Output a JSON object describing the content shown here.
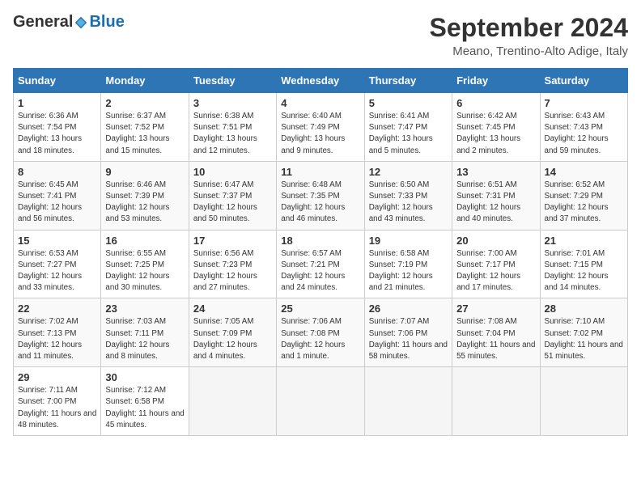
{
  "logo": {
    "general": "General",
    "blue": "Blue"
  },
  "header": {
    "month": "September 2024",
    "location": "Meano, Trentino-Alto Adige, Italy"
  },
  "columns": [
    "Sunday",
    "Monday",
    "Tuesday",
    "Wednesday",
    "Thursday",
    "Friday",
    "Saturday"
  ],
  "weeks": [
    [
      {
        "day": "1",
        "sunrise": "6:36 AM",
        "sunset": "7:54 PM",
        "daylight": "13 hours and 18 minutes."
      },
      {
        "day": "2",
        "sunrise": "6:37 AM",
        "sunset": "7:52 PM",
        "daylight": "13 hours and 15 minutes."
      },
      {
        "day": "3",
        "sunrise": "6:38 AM",
        "sunset": "7:51 PM",
        "daylight": "13 hours and 12 minutes."
      },
      {
        "day": "4",
        "sunrise": "6:40 AM",
        "sunset": "7:49 PM",
        "daylight": "13 hours and 9 minutes."
      },
      {
        "day": "5",
        "sunrise": "6:41 AM",
        "sunset": "7:47 PM",
        "daylight": "13 hours and 5 minutes."
      },
      {
        "day": "6",
        "sunrise": "6:42 AM",
        "sunset": "7:45 PM",
        "daylight": "13 hours and 2 minutes."
      },
      {
        "day": "7",
        "sunrise": "6:43 AM",
        "sunset": "7:43 PM",
        "daylight": "12 hours and 59 minutes."
      }
    ],
    [
      {
        "day": "8",
        "sunrise": "6:45 AM",
        "sunset": "7:41 PM",
        "daylight": "12 hours and 56 minutes."
      },
      {
        "day": "9",
        "sunrise": "6:46 AM",
        "sunset": "7:39 PM",
        "daylight": "12 hours and 53 minutes."
      },
      {
        "day": "10",
        "sunrise": "6:47 AM",
        "sunset": "7:37 PM",
        "daylight": "12 hours and 50 minutes."
      },
      {
        "day": "11",
        "sunrise": "6:48 AM",
        "sunset": "7:35 PM",
        "daylight": "12 hours and 46 minutes."
      },
      {
        "day": "12",
        "sunrise": "6:50 AM",
        "sunset": "7:33 PM",
        "daylight": "12 hours and 43 minutes."
      },
      {
        "day": "13",
        "sunrise": "6:51 AM",
        "sunset": "7:31 PM",
        "daylight": "12 hours and 40 minutes."
      },
      {
        "day": "14",
        "sunrise": "6:52 AM",
        "sunset": "7:29 PM",
        "daylight": "12 hours and 37 minutes."
      }
    ],
    [
      {
        "day": "15",
        "sunrise": "6:53 AM",
        "sunset": "7:27 PM",
        "daylight": "12 hours and 33 minutes."
      },
      {
        "day": "16",
        "sunrise": "6:55 AM",
        "sunset": "7:25 PM",
        "daylight": "12 hours and 30 minutes."
      },
      {
        "day": "17",
        "sunrise": "6:56 AM",
        "sunset": "7:23 PM",
        "daylight": "12 hours and 27 minutes."
      },
      {
        "day": "18",
        "sunrise": "6:57 AM",
        "sunset": "7:21 PM",
        "daylight": "12 hours and 24 minutes."
      },
      {
        "day": "19",
        "sunrise": "6:58 AM",
        "sunset": "7:19 PM",
        "daylight": "12 hours and 21 minutes."
      },
      {
        "day": "20",
        "sunrise": "7:00 AM",
        "sunset": "7:17 PM",
        "daylight": "12 hours and 17 minutes."
      },
      {
        "day": "21",
        "sunrise": "7:01 AM",
        "sunset": "7:15 PM",
        "daylight": "12 hours and 14 minutes."
      }
    ],
    [
      {
        "day": "22",
        "sunrise": "7:02 AM",
        "sunset": "7:13 PM",
        "daylight": "12 hours and 11 minutes."
      },
      {
        "day": "23",
        "sunrise": "7:03 AM",
        "sunset": "7:11 PM",
        "daylight": "12 hours and 8 minutes."
      },
      {
        "day": "24",
        "sunrise": "7:05 AM",
        "sunset": "7:09 PM",
        "daylight": "12 hours and 4 minutes."
      },
      {
        "day": "25",
        "sunrise": "7:06 AM",
        "sunset": "7:08 PM",
        "daylight": "12 hours and 1 minute."
      },
      {
        "day": "26",
        "sunrise": "7:07 AM",
        "sunset": "7:06 PM",
        "daylight": "11 hours and 58 minutes."
      },
      {
        "day": "27",
        "sunrise": "7:08 AM",
        "sunset": "7:04 PM",
        "daylight": "11 hours and 55 minutes."
      },
      {
        "day": "28",
        "sunrise": "7:10 AM",
        "sunset": "7:02 PM",
        "daylight": "11 hours and 51 minutes."
      }
    ],
    [
      {
        "day": "29",
        "sunrise": "7:11 AM",
        "sunset": "7:00 PM",
        "daylight": "11 hours and 48 minutes."
      },
      {
        "day": "30",
        "sunrise": "7:12 AM",
        "sunset": "6:58 PM",
        "daylight": "11 hours and 45 minutes."
      },
      null,
      null,
      null,
      null,
      null
    ]
  ]
}
